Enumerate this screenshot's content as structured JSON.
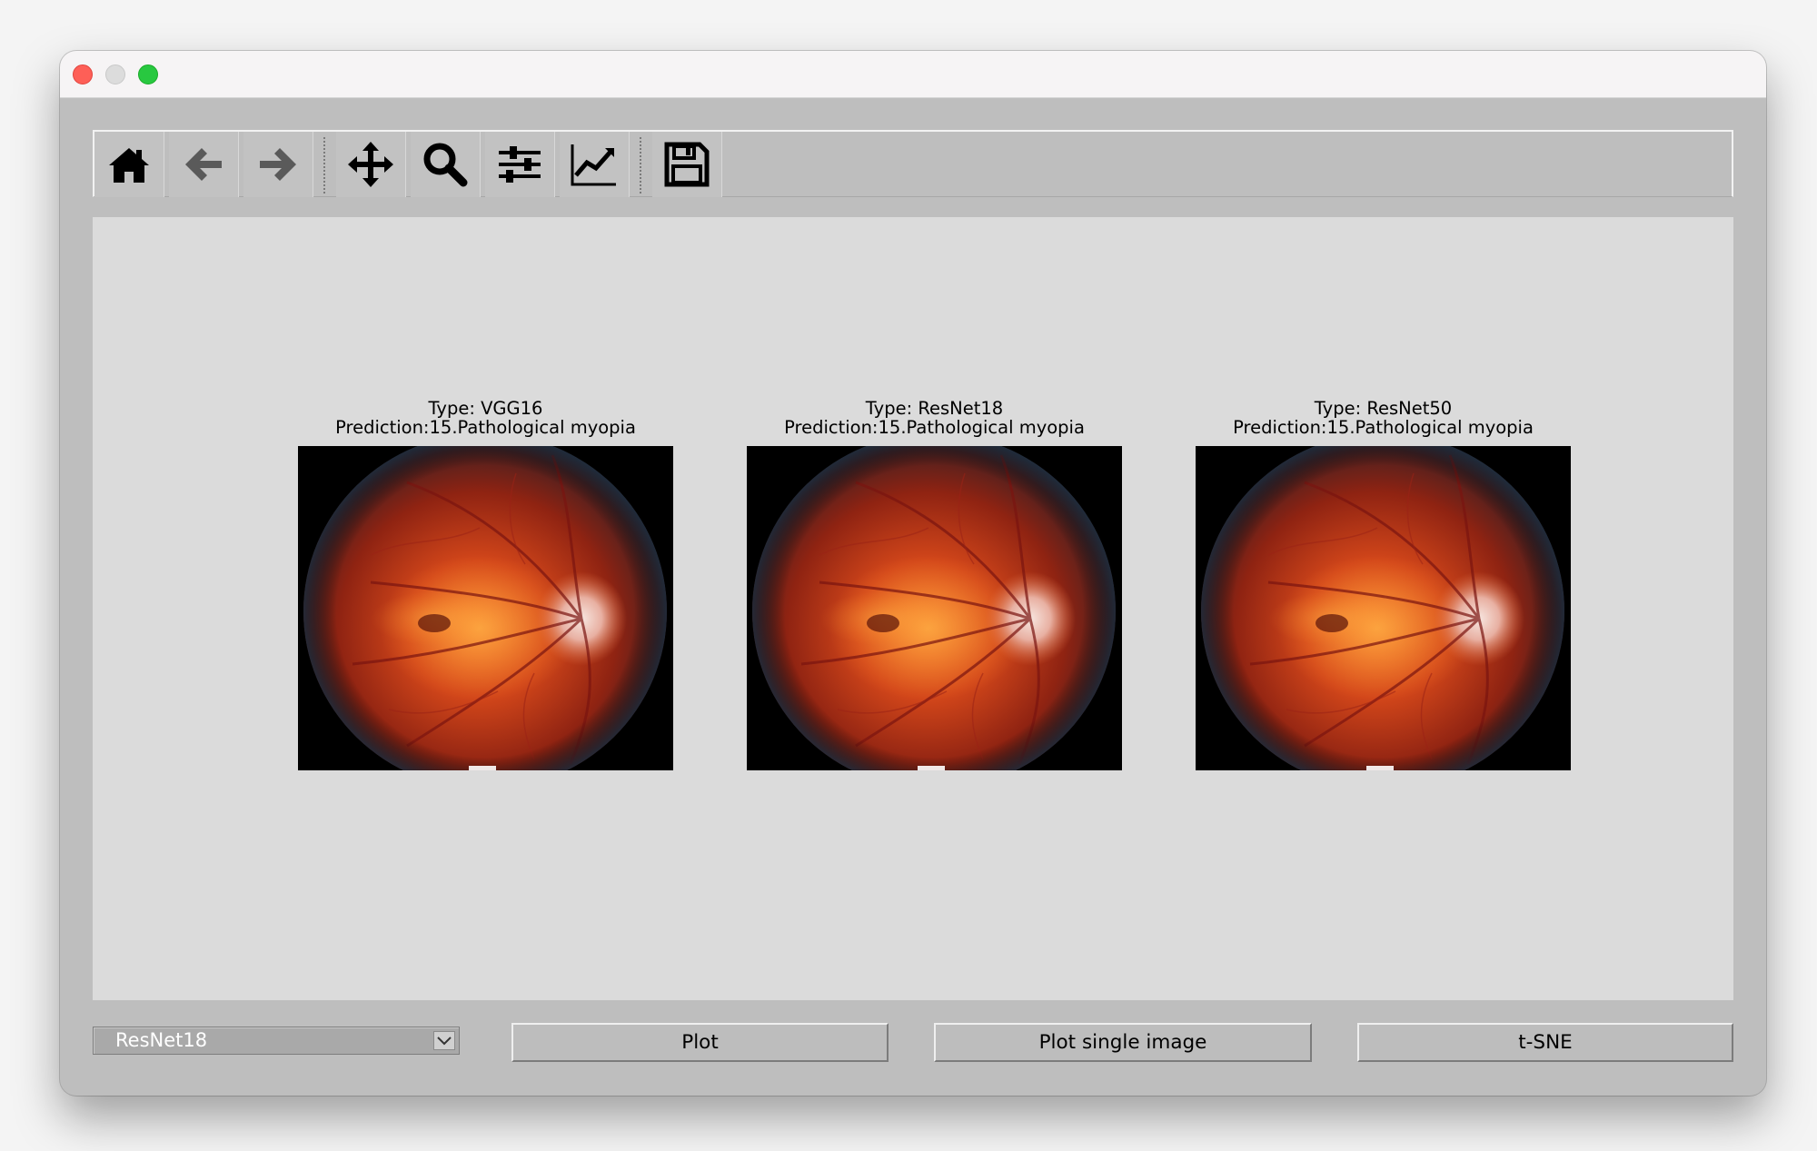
{
  "toolbar": {
    "tools": [
      {
        "icon": "home-icon"
      },
      {
        "icon": "back-arrow-icon"
      },
      {
        "icon": "forward-arrow-icon"
      },
      {
        "icon": "pan-move-icon"
      },
      {
        "icon": "zoom-icon"
      },
      {
        "icon": "configure-subplots-icon"
      },
      {
        "icon": "edit-axis-icon"
      },
      {
        "icon": "save-icon"
      }
    ]
  },
  "figure": {
    "panels": [
      {
        "type_line": "Type: VGG16",
        "prediction_line": "Prediction:15.Pathological myopia"
      },
      {
        "type_line": "Type: ResNet18",
        "prediction_line": "Prediction:15.Pathological myopia"
      },
      {
        "type_line": "Type: ResNet50",
        "prediction_line": "Prediction:15.Pathological myopia"
      }
    ]
  },
  "controls": {
    "model_select": {
      "value": "ResNet18"
    },
    "plot_button": "Plot",
    "plot_single_button": "Plot single image",
    "tsne_button": "t-SNE"
  },
  "colors": {
    "window_bg": "#bebebe",
    "canvas_bg": "#dbdbdb",
    "close": "#fe5f57",
    "maximize": "#28c840"
  }
}
